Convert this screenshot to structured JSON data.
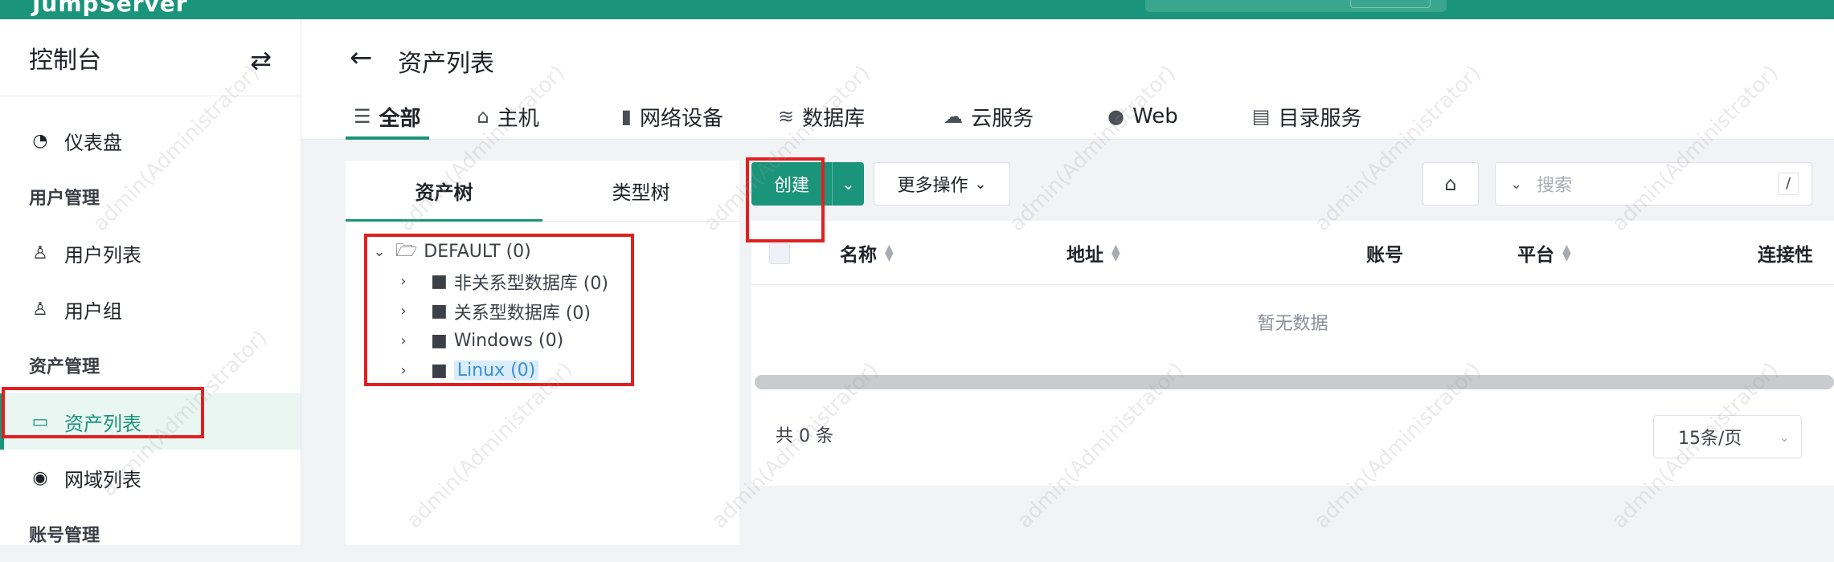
{
  "topbar": {
    "logo": "JumpServer"
  },
  "sidebar": {
    "title": "控制台",
    "items": [
      {
        "kind": "item",
        "icon": "dashboard-icon",
        "label": "仪表盘"
      },
      {
        "kind": "group",
        "label": "用户管理"
      },
      {
        "kind": "item",
        "icon": "user-icon",
        "label": "用户列表"
      },
      {
        "kind": "item",
        "icon": "user-group-icon",
        "label": "用户组"
      },
      {
        "kind": "group",
        "label": "资产管理"
      },
      {
        "kind": "item",
        "icon": "monitor-icon",
        "label": "资产列表",
        "active": true
      },
      {
        "kind": "item",
        "icon": "location-icon",
        "label": "网域列表"
      },
      {
        "kind": "group",
        "label": "账号管理"
      }
    ]
  },
  "header": {
    "title": "资产列表",
    "tabs": [
      {
        "icon": "list-icon",
        "label": "全部",
        "active": true
      },
      {
        "icon": "host-icon",
        "label": "主机"
      },
      {
        "icon": "network-device-icon",
        "label": "网络设备"
      },
      {
        "icon": "database-icon",
        "label": "数据库"
      },
      {
        "icon": "cloud-icon",
        "label": "云服务"
      },
      {
        "icon": "globe-icon",
        "label": "Web"
      },
      {
        "icon": "directory-icon",
        "label": "目录服务"
      }
    ]
  },
  "tree": {
    "tabs": [
      "资产树",
      "类型树"
    ],
    "root": "DEFAULT (0)",
    "children": [
      "非关系型数据库 (0)",
      "关系型数据库 (0)",
      "Windows (0)",
      "Linux (0)"
    ]
  },
  "toolbar": {
    "create_label": "创建",
    "more_label": "更多操作",
    "search_placeholder": "搜索",
    "search_shortcut": "/"
  },
  "table": {
    "columns": [
      "名称",
      "地址",
      "账号",
      "平台",
      "连接性"
    ],
    "empty_text": "暂无数据",
    "total_text": "共 0 条",
    "page_size": "15条/页"
  },
  "watermark": "admin(Administrator)",
  "colors": {
    "brand": "#1a947a",
    "annotation": "#e02020"
  }
}
